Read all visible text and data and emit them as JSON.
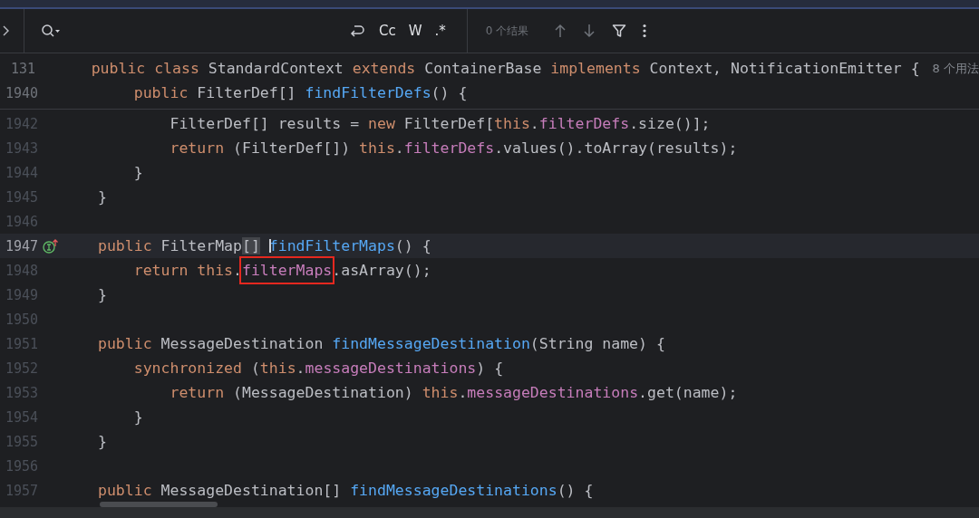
{
  "search_bar": {
    "toggles": [
      {
        "label": "Cc"
      },
      {
        "label": "W"
      },
      {
        "label": ".*"
      }
    ],
    "results": "0 个结果"
  },
  "sticky_lines": [
    {
      "number": "131",
      "tokens": [
        {
          "kind": "kw",
          "text": "public class "
        },
        {
          "kind": "plain",
          "text": "StandardContext "
        },
        {
          "kind": "kw",
          "text": "extends "
        },
        {
          "kind": "plain",
          "text": "ContainerBase "
        },
        {
          "kind": "kw",
          "text": "implements "
        },
        {
          "kind": "plain",
          "text": "Context, NotificationEmitter {"
        }
      ],
      "hint": "8 个用法"
    },
    {
      "number": "1940",
      "tokens": [
        {
          "kind": "kw",
          "text": "    public "
        },
        {
          "kind": "plain",
          "text": "FilterDef[] "
        },
        {
          "kind": "fn",
          "text": "findFilterDefs"
        },
        {
          "kind": "plain",
          "text": "() {"
        }
      ]
    }
  ],
  "lines": [
    {
      "number": "1942",
      "current": false,
      "tokens": [
        {
          "kind": "plain",
          "text": "        FilterDef[] results = "
        },
        {
          "kind": "kw",
          "text": "new "
        },
        {
          "kind": "plain",
          "text": "FilterDef["
        },
        {
          "kind": "kw",
          "text": "this"
        },
        {
          "kind": "plain",
          "text": "."
        },
        {
          "kind": "field",
          "text": "filterDefs"
        },
        {
          "kind": "plain",
          "text": ".size()];"
        }
      ]
    },
    {
      "number": "1943",
      "current": false,
      "tokens": [
        {
          "kind": "kw",
          "text": "        return "
        },
        {
          "kind": "plain",
          "text": "(FilterDef[]) "
        },
        {
          "kind": "kw",
          "text": "this"
        },
        {
          "kind": "plain",
          "text": "."
        },
        {
          "kind": "field",
          "text": "filterDefs"
        },
        {
          "kind": "plain",
          "text": ".values().toArray(results);"
        }
      ]
    },
    {
      "number": "1944",
      "current": false,
      "tokens": [
        {
          "kind": "plain",
          "text": "    }"
        }
      ]
    },
    {
      "number": "1945",
      "current": false,
      "tokens": [
        {
          "kind": "plain",
          "text": "}"
        }
      ]
    },
    {
      "number": "1946",
      "current": false
    },
    {
      "number": "1947",
      "current": true,
      "gutter_icon": true,
      "tokens": [
        {
          "kind": "kw",
          "text": "public "
        },
        {
          "kind": "plain",
          "text": "FilterMap"
        },
        {
          "kind": "plain",
          "text": "[]",
          "matched": true
        },
        {
          "kind": "fn",
          "text": " findFilterMaps",
          "caret": true
        },
        {
          "kind": "plain",
          "text": "() {"
        }
      ]
    },
    {
      "number": "1948",
      "current": false,
      "tokens": [
        {
          "kind": "kw",
          "text": "    return this"
        },
        {
          "kind": "plain",
          "text": "."
        },
        {
          "kind": "field",
          "text": "filterMaps",
          "boxed": true
        },
        {
          "kind": "plain",
          "text": ".asArray();"
        }
      ]
    },
    {
      "number": "1949",
      "current": false,
      "tokens": [
        {
          "kind": "plain",
          "text": "}"
        }
      ]
    },
    {
      "number": "1950",
      "current": false
    },
    {
      "number": "1951",
      "current": false,
      "tokens": [
        {
          "kind": "kw",
          "text": "public "
        },
        {
          "kind": "plain",
          "text": "MessageDestination "
        },
        {
          "kind": "fn",
          "text": "findMessageDestination"
        },
        {
          "kind": "plain",
          "text": "(String name) {"
        }
      ]
    },
    {
      "number": "1952",
      "current": false,
      "tokens": [
        {
          "kind": "kw",
          "text": "    synchronized "
        },
        {
          "kind": "plain",
          "text": "("
        },
        {
          "kind": "kw",
          "text": "this"
        },
        {
          "kind": "plain",
          "text": "."
        },
        {
          "kind": "field",
          "text": "messageDestinations"
        },
        {
          "kind": "plain",
          "text": ") {"
        }
      ]
    },
    {
      "number": "1953",
      "current": false,
      "tokens": [
        {
          "kind": "kw",
          "text": "        return "
        },
        {
          "kind": "plain",
          "text": "(MessageDestination) "
        },
        {
          "kind": "kw",
          "text": "this"
        },
        {
          "kind": "plain",
          "text": "."
        },
        {
          "kind": "field",
          "text": "messageDestinations"
        },
        {
          "kind": "plain",
          "text": ".get(name);"
        }
      ]
    },
    {
      "number": "1954",
      "current": false,
      "tokens": [
        {
          "kind": "plain",
          "text": "    }"
        }
      ]
    },
    {
      "number": "1955",
      "current": false,
      "tokens": [
        {
          "kind": "plain",
          "text": "}"
        }
      ]
    },
    {
      "number": "1956",
      "current": false
    },
    {
      "number": "1957",
      "current": false,
      "tokens": [
        {
          "kind": "kw",
          "text": "public "
        },
        {
          "kind": "plain",
          "text": "MessageDestination[] "
        },
        {
          "kind": "fn",
          "text": "findMessageDestinations"
        },
        {
          "kind": "plain",
          "text": "() {"
        }
      ]
    }
  ]
}
